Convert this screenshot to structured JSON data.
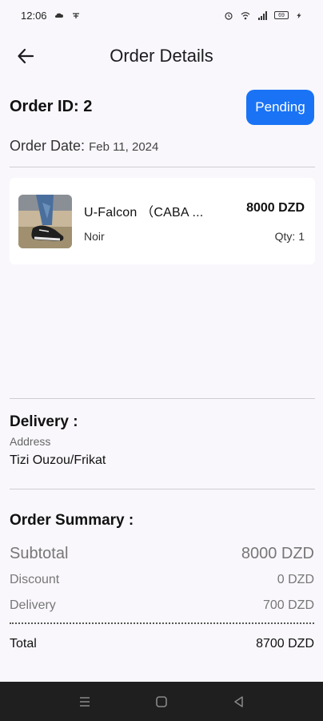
{
  "status_bar": {
    "time": "12:06",
    "battery": "69",
    "icons_left": [
      "cloud-icon",
      "emoji-icon"
    ],
    "icons_right": [
      "alarm-icon",
      "wifi-icon",
      "signal-icon",
      "battery-icon",
      "charging-icon"
    ]
  },
  "app_bar": {
    "title": "Order Details",
    "back_icon": "arrow-left-icon"
  },
  "order": {
    "id_label": "Order ID: 2",
    "status": "Pending",
    "date_label": "Order Date:",
    "date_value": "Feb 11, 2024",
    "status_color": "#1a73f5"
  },
  "items": [
    {
      "name": "U-Falcon （CABA ...",
      "price": "8000 DZD",
      "variant": "Noir",
      "qty": "Qty: 1"
    }
  ],
  "delivery": {
    "title": "Delivery :",
    "address_label": "Address",
    "address_value": "Tizi Ouzou/Frikat"
  },
  "summary": {
    "title": "Order Summary :",
    "subtotal_label": "Subtotal",
    "subtotal_value": "8000 DZD",
    "discount_label": "Discount",
    "discount_value": "0 DZD",
    "delivery_label": "Delivery",
    "delivery_value": "700 DZD",
    "total_label": "Total",
    "total_value": "8700 DZD"
  },
  "nav_bar": {
    "icons": [
      "menu-icon",
      "home-square-icon",
      "back-triangle-icon"
    ]
  }
}
